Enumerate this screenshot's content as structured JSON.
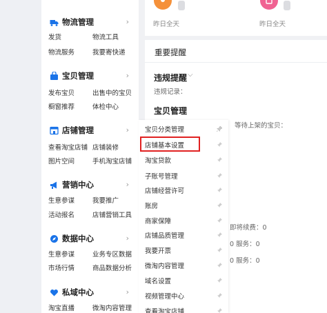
{
  "sidebar": {
    "sections": [
      {
        "title": "物流管理",
        "icon": "truck-icon",
        "links": [
          "发货",
          "物流工具",
          "物流服务",
          "我要寄快递"
        ]
      },
      {
        "title": "宝贝管理",
        "icon": "bag-icon",
        "links": [
          "发布宝贝",
          "出售中的宝贝",
          "橱窗推荐",
          "体检中心"
        ]
      },
      {
        "title": "店铺管理",
        "icon": "shop-icon",
        "links": [
          "查看淘宝店铺",
          "店铺装修",
          "图片空间",
          "手机淘宝店铺"
        ]
      },
      {
        "title": "营销中心",
        "icon": "megaphone-icon",
        "links": [
          "生意参谋",
          "我要推广",
          "活动报名",
          "店铺营销工具"
        ]
      },
      {
        "title": "数据中心",
        "icon": "compass-icon",
        "links": [
          "生意参谋",
          "业务专区数据",
          "市场行情",
          "商品数据分析"
        ]
      },
      {
        "title": "私域中心",
        "icon": "heart-icon",
        "links": [
          "淘宝直播",
          "微淘内容管理"
        ]
      }
    ]
  },
  "submenu": {
    "items": [
      "宝贝分类管理",
      "店铺基本设置",
      "淘宝贷款",
      "子账号管理",
      "店铺经营许可",
      "账房",
      "商家保障",
      "店铺品质管理",
      "我要开票",
      "微淘内容管理",
      "域名设置",
      "视频管理中心",
      "查看淘宝店铺"
    ],
    "highlighted": "店铺基本设置"
  },
  "top_stats": {
    "left_label": "昨日全天",
    "right_label": "昨日全天",
    "left_color": "#f5913a",
    "right_color": "#f06292"
  },
  "reminders": {
    "title": "重要提醒",
    "violation_title": "违规提醒",
    "violation_record": "违规记录：",
    "goods_title": "宝贝管理",
    "waiting_text": "等待上架的宝贝：",
    "renew_text": "即将续费：0",
    "rows": [
      "0",
      "0 服务：0",
      "0 服务：0"
    ]
  }
}
